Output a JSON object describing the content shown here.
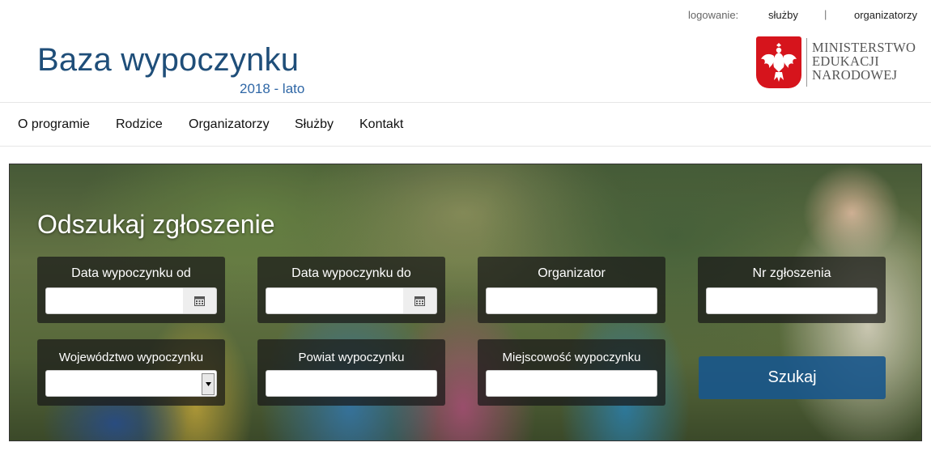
{
  "topbar": {
    "login_label": "logowanie:",
    "link_services": "służby",
    "separator": "|",
    "link_organizers": "organizatorzy"
  },
  "brand": {
    "title": "Baza wypoczynku",
    "subtitle": "2018 - lato",
    "ministry_line1": "MINISTERSTWO",
    "ministry_line2": "EDUKACJI",
    "ministry_line3": "NARODOWEJ"
  },
  "nav": {
    "items": [
      {
        "label": "O programie"
      },
      {
        "label": "Rodzice"
      },
      {
        "label": "Organizatorzy"
      },
      {
        "label": "Służby"
      },
      {
        "label": "Kontakt"
      }
    ]
  },
  "search": {
    "title": "Odszukaj zgłoszenie",
    "date_from_label": "Data wypoczynku od",
    "date_to_label": "Data wypoczynku do",
    "organizer_label": "Organizator",
    "number_label": "Nr zgłoszenia",
    "voivodeship_label": "Województwo wypoczynku",
    "county_label": "Powiat wypoczynku",
    "locality_label": "Miejscowość wypoczynku",
    "button_label": "Szukaj",
    "date_from_value": "",
    "date_to_value": "",
    "organizer_value": "",
    "number_value": "",
    "voivodeship_value": "",
    "county_value": "",
    "locality_value": ""
  },
  "colors": {
    "brand_blue": "#1f4e79",
    "subtitle_blue": "#2f67a6",
    "emblem_red": "#d6141c",
    "button_blue": "#18568c"
  }
}
